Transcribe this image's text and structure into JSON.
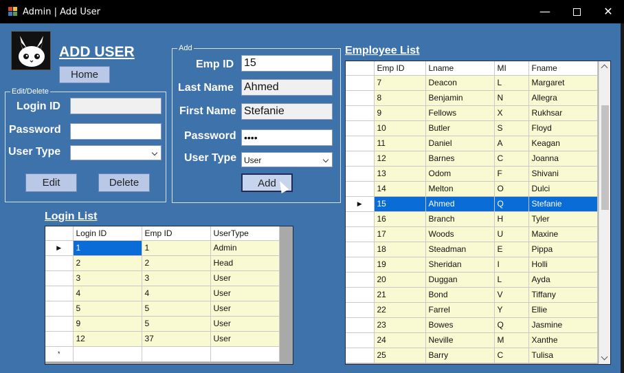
{
  "window": {
    "title": "Admin | Add User",
    "icon_colors": [
      "#d04a2a",
      "#f0c040",
      "#3a78c8",
      "#50a050"
    ],
    "minimize_label": "—",
    "close_label": "✕"
  },
  "header": {
    "title": "ADD USER",
    "home_label": "Home"
  },
  "edit_delete": {
    "legend": "Edit/Delete",
    "login_id_label": "Login ID",
    "login_id_value": "",
    "password_label": "Password",
    "password_value": "",
    "user_type_label": "User Type",
    "user_type_value": "",
    "edit_label": "Edit",
    "delete_label": "Delete"
  },
  "add": {
    "legend": "Add",
    "emp_id_label": "Emp ID",
    "emp_id_value": "15",
    "last_name_label": "Last Name",
    "last_name_value": "Ahmed",
    "first_name_label": "First Name",
    "first_name_value": "Stefanie",
    "password_label": "Password",
    "password_value": "••••",
    "user_type_label": "User Type",
    "user_type_value": "User",
    "add_label": "Add"
  },
  "login_list": {
    "title": "Login List",
    "columns": [
      "Login ID",
      "Emp ID",
      "UserType"
    ],
    "rows": [
      [
        "1",
        "1",
        "Admin"
      ],
      [
        "2",
        "2",
        "Head"
      ],
      [
        "3",
        "3",
        "User"
      ],
      [
        "4",
        "4",
        "User"
      ],
      [
        "5",
        "5",
        "User"
      ],
      [
        "9",
        "5",
        "User"
      ],
      [
        "12",
        "37",
        "User"
      ]
    ],
    "current_row_marker": "▶",
    "new_row_marker": "*"
  },
  "employee_list": {
    "title": "Employee List",
    "columns": [
      "Emp ID",
      "Lname",
      "MI",
      "Fname"
    ],
    "rows": [
      [
        "7",
        "Deacon",
        "L",
        "Margaret"
      ],
      [
        "8",
        "Benjamin",
        "N",
        "Allegra"
      ],
      [
        "9",
        "Fellows",
        "X",
        "Rukhsar"
      ],
      [
        "10",
        "Butler",
        "S",
        "Floyd"
      ],
      [
        "11",
        "Daniel",
        "A",
        "Keagan"
      ],
      [
        "12",
        "Barnes",
        "C",
        "Joanna"
      ],
      [
        "13",
        "Odom",
        "F",
        "Shivani"
      ],
      [
        "14",
        "Melton",
        "O",
        "Dulci"
      ],
      [
        "15",
        "Ahmed",
        "Q",
        "Stefanie"
      ],
      [
        "16",
        "Branch",
        "H",
        "Tyler"
      ],
      [
        "17",
        "Woods",
        "U",
        "Maxine"
      ],
      [
        "18",
        "Steadman",
        "E",
        "Pippa"
      ],
      [
        "19",
        "Sheridan",
        "I",
        "Holli"
      ],
      [
        "20",
        "Duggan",
        "L",
        "Ayda"
      ],
      [
        "21",
        "Bond",
        "V",
        "Tiffany"
      ],
      [
        "22",
        "Farrel",
        "Y",
        "Ellie"
      ],
      [
        "23",
        "Bowes",
        "Q",
        "Jasmine"
      ],
      [
        "24",
        "Neville",
        "M",
        "Xanthe"
      ],
      [
        "25",
        "Barry",
        "C",
        "Tulisa"
      ]
    ],
    "selected_emp_id": "15",
    "current_row_marker": "▶"
  },
  "colors": {
    "form_background": "#3e72ab",
    "grid_cell": "#fafad2",
    "selection": "#0a6cd6"
  }
}
